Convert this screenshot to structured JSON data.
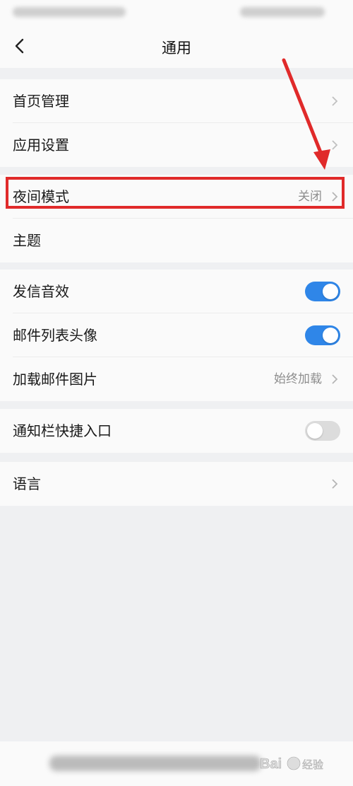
{
  "nav": {
    "title": "通用"
  },
  "group1": [
    {
      "label": "首页管理"
    },
    {
      "label": "应用设置"
    }
  ],
  "group2": [
    {
      "label": "夜间模式",
      "value": "关闭"
    },
    {
      "label": "主题"
    }
  ],
  "group3": [
    {
      "label": "发信音效",
      "toggle": "on"
    },
    {
      "label": "邮件列表头像",
      "toggle": "on"
    },
    {
      "label": "加载邮件图片",
      "value": "始终加载"
    }
  ],
  "group4": [
    {
      "label": "通知栏快捷入口",
      "toggle": "off"
    }
  ],
  "group5": [
    {
      "label": "语言"
    }
  ],
  "colors": {
    "accent": "#2f86e8",
    "highlight": "#e02a2a",
    "background": "#eff0f2"
  },
  "icons": [
    "back-icon",
    "chevron-right-icon",
    "arrow-annotation"
  ]
}
